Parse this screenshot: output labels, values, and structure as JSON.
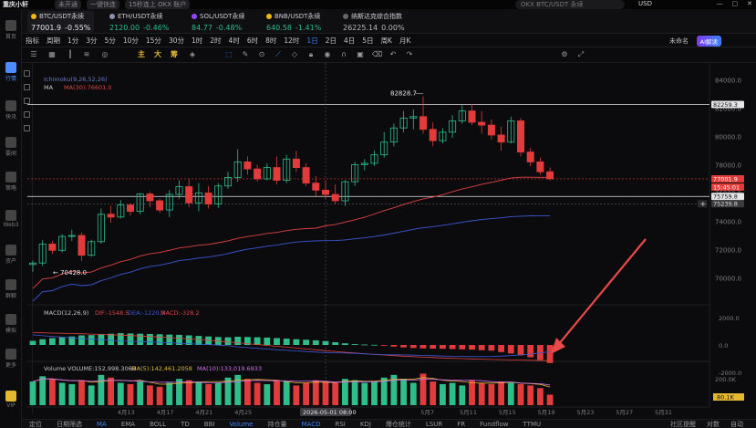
{
  "topbar": {
    "brand": "重庆小轩",
    "pills": [
      "未开通",
      "一键快连",
      "15秒连上 OKX 账户"
    ],
    "search_placeholder": "OKX BTC/USDT 永续",
    "currency": "USD",
    "window_controls": [
      "—",
      "▢",
      "✕"
    ]
  },
  "sidebar": {
    "items": [
      {
        "label": "首页",
        "icon": "home-icon"
      },
      {
        "label": "行情",
        "icon": "market-icon",
        "active": true
      },
      {
        "label": "快讯",
        "icon": "news-icon"
      },
      {
        "label": "要闻",
        "icon": "headline-icon"
      },
      {
        "label": "策略",
        "icon": "strategy-icon"
      },
      {
        "label": "Web3",
        "icon": "web3-icon"
      },
      {
        "label": "资产",
        "icon": "assets-icon"
      },
      {
        "label": "群聊",
        "icon": "chat-icon"
      },
      {
        "label": "模拟",
        "icon": "simulate-icon"
      },
      {
        "label": "更多",
        "icon": "more-icon"
      },
      {
        "label": "VIP",
        "icon": "vip-icon"
      }
    ]
  },
  "tickers": [
    {
      "name": "BTC/USDT永续",
      "price": "77001.9",
      "change": "-0.55%",
      "color": "#f0b90b",
      "selected": true
    },
    {
      "name": "ETH/USDT永续",
      "price": "2120.00",
      "change": "-0.46%",
      "color": "#8a92b2"
    },
    {
      "name": "SOL/USDT永续",
      "price": "84.77",
      "change": "-0.48%",
      "color": "#9945ff"
    },
    {
      "name": "BNB/USDT永续",
      "price": "640.58",
      "change": "-1.41%",
      "color": "#f0b90b"
    },
    {
      "name": "纳斯达克综合指数",
      "price": "26225.14",
      "change": "0.00%",
      "color": "#666"
    }
  ],
  "timeframes": {
    "indicator_label": "指标",
    "cycle_label": "周期",
    "items": [
      "1分",
      "3分",
      "5分",
      "10分",
      "15分",
      "30分",
      "1时",
      "2时",
      "4时",
      "6时",
      "8时",
      "12时",
      "1日",
      "2日",
      "4日",
      "5日",
      "周K",
      "月K"
    ],
    "active": "1日",
    "not_done": "未命名",
    "ai_button": "AI解读"
  },
  "toolbar": {
    "main_labels": [
      "主",
      "大",
      "筹"
    ]
  },
  "indicators": {
    "ichimoku": "Ichimoku(9,26,52,26)",
    "ma_main": "MA",
    "ma_values": "MA(30):76601.0",
    "macd_title": "MACD(12,26,9)",
    "macd_dif": "DIF:-1548.5",
    "macd_dea": "DEA:-1220.3",
    "macd_val": "MACD:-328.2",
    "vol_title": "Volume",
    "vol_val": "VOLUME:152,998.3060",
    "vol_ma5": "MA(5):142,461.2058",
    "vol_ma10": "MA(10):133,019.6933"
  },
  "price_axis": {
    "ticks": [
      "84000.0",
      "82000.0",
      "80000.0",
      "78000.0",
      "76000.0",
      "74000.0",
      "72000.0",
      "70000.0"
    ],
    "tags": [
      {
        "value": "82259.3",
        "bg": "#e6e6e8",
        "fg": "#111"
      },
      {
        "value": "77001.9",
        "bg": "#e23b3b",
        "fg": "#fff"
      },
      {
        "value": "15:45:01",
        "bg": "#e23b3b",
        "fg": "#fff"
      },
      {
        "value": "75759.8",
        "bg": "#e6e6e8",
        "fg": "#111"
      },
      {
        "value": "75239.8",
        "bg": "#3a3a3f",
        "fg": "#ddd"
      }
    ],
    "macd_ticks": [
      "2000.0",
      "0.0",
      "-2000.0"
    ],
    "vol_ticks": [
      "200.0K"
    ],
    "vol_tag": "80.1K"
  },
  "annotations": {
    "high": "82828.7",
    "low": "70428.0",
    "crosshair_date": "2026-05-01 08:00"
  },
  "time_axis": [
    "4月13",
    "4月17",
    "4月21",
    "4月25",
    "5月7",
    "5月11",
    "5月15",
    "5月19",
    "5月23",
    "5月27",
    "5月31"
  ],
  "bottombar": {
    "items": [
      "定位",
      "日期筛选",
      "MA",
      "EMA",
      "BOLL",
      "TD",
      "BBI",
      "Volume",
      "持仓量",
      "MACD",
      "RSI",
      "KDJ",
      "爆仓统计",
      "LSUR",
      "FR",
      "Fundflow",
      "TTMU"
    ],
    "active": [
      "MA",
      "Volume",
      "MACD"
    ],
    "right": [
      "社区提醒",
      "对数",
      "自动"
    ]
  },
  "colors": {
    "up": "#2fbd8a",
    "down": "#e23b3b",
    "accent": "#3b82f6",
    "ma30": "#e04242",
    "ma_blue": "#3b58d6"
  },
  "chart_data": {
    "type": "candlestick",
    "candles": [
      [
        70950,
        71220,
        70428,
        71050
      ],
      [
        71050,
        72680,
        70860,
        72390
      ],
      [
        72390,
        72600,
        71700,
        71950
      ],
      [
        71950,
        73100,
        71800,
        72930
      ],
      [
        72930,
        73400,
        72600,
        73000
      ],
      [
        73000,
        73200,
        71200,
        71600
      ],
      [
        71600,
        72700,
        71500,
        72560
      ],
      [
        72560,
        74900,
        72400,
        74500
      ],
      [
        74500,
        75100,
        73900,
        74300
      ],
      [
        74300,
        75500,
        74200,
        75160
      ],
      [
        75160,
        75300,
        74400,
        74700
      ],
      [
        74700,
        76000,
        74500,
        75930
      ],
      [
        75930,
        76100,
        75000,
        75450
      ],
      [
        75450,
        75600,
        74600,
        74800
      ],
      [
        74800,
        76200,
        74300,
        75900
      ],
      [
        75900,
        76900,
        75600,
        76450
      ],
      [
        76450,
        77000,
        75000,
        75300
      ],
      [
        75300,
        76700,
        74700,
        76000
      ],
      [
        76000,
        76500,
        74900,
        75220
      ],
      [
        75220,
        76700,
        74950,
        76500
      ],
      [
        76500,
        77500,
        76300,
        77100
      ],
      [
        77100,
        79100,
        76800,
        78200
      ],
      [
        78200,
        78600,
        77300,
        77700
      ],
      [
        77700,
        78000,
        76800,
        77000
      ],
      [
        77000,
        78100,
        76900,
        77800
      ],
      [
        77800,
        78600,
        76600,
        76900
      ],
      [
        76900,
        78700,
        76700,
        78400
      ],
      [
        78400,
        79000,
        77500,
        77800
      ],
      [
        77800,
        78100,
        76500,
        76700
      ],
      [
        76700,
        77200,
        75800,
        76200
      ],
      [
        76200,
        76900,
        75600,
        75900
      ],
      [
        75900,
        76600,
        75200,
        75450
      ],
      [
        75450,
        76900,
        75100,
        76800
      ],
      [
        76800,
        78200,
        76500,
        78000
      ],
      [
        78000,
        78400,
        77600,
        78100
      ],
      [
        78100,
        79000,
        77900,
        78700
      ],
      [
        78700,
        80300,
        78500,
        79600
      ],
      [
        79600,
        80900,
        79300,
        80600
      ],
      [
        80600,
        81800,
        80300,
        81300
      ],
      [
        81300,
        81900,
        80500,
        81400
      ],
      [
        81400,
        82828.7,
        80200,
        80500
      ],
      [
        80500,
        81000,
        79300,
        79700
      ],
      [
        79700,
        80600,
        79500,
        80300
      ],
      [
        80300,
        81500,
        79900,
        81100
      ],
      [
        81100,
        82200,
        80900,
        81800
      ],
      [
        81800,
        82300,
        80800,
        81000
      ],
      [
        81000,
        81800,
        80200,
        80800
      ],
      [
        80800,
        81200,
        79800,
        80100
      ],
      [
        80100,
        80700,
        79000,
        79600
      ],
      [
        79600,
        81400,
        79500,
        81100
      ],
      [
        81100,
        81300,
        78600,
        78900
      ],
      [
        78900,
        79200,
        77900,
        78200
      ],
      [
        78200,
        78500,
        77300,
        77500
      ],
      [
        77500,
        77800,
        76900,
        77001.9
      ]
    ],
    "macd_hist": [
      300,
      420,
      500,
      560,
      620,
      700,
      720,
      760,
      820,
      860,
      840,
      820,
      800,
      780,
      760,
      740,
      700,
      660,
      620,
      580,
      560,
      600,
      580,
      560,
      540,
      500,
      460,
      420,
      380,
      340,
      280,
      200,
      120,
      60,
      30,
      10,
      -60,
      -120,
      -180,
      -220,
      -250,
      -270,
      -280,
      -300,
      -320,
      -340,
      -380,
      -420,
      -520,
      -620,
      -760,
      -900,
      -1100,
      -1320
    ],
    "volume": [
      180,
      220,
      200,
      170,
      160,
      190,
      150,
      230,
      210,
      170,
      160,
      180,
      150,
      140,
      170,
      200,
      190,
      180,
      160,
      170,
      210,
      230,
      200,
      170,
      160,
      190,
      180,
      150,
      170,
      190,
      180,
      170,
      200,
      190,
      170,
      180,
      210,
      230,
      200,
      170,
      240,
      180,
      160,
      170,
      150,
      190,
      170,
      160,
      180,
      170,
      160,
      150,
      130,
      80
    ]
  }
}
